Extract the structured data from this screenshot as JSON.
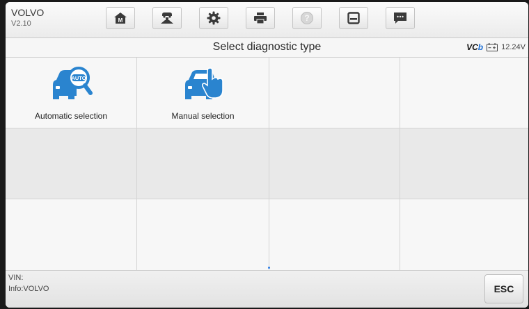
{
  "header": {
    "make": "VOLVO",
    "version": "V2.10",
    "toolbar": [
      {
        "icon": "home-m-icon"
      },
      {
        "icon": "vehicle-lift-icon"
      },
      {
        "icon": "gear-icon"
      },
      {
        "icon": "printer-icon"
      },
      {
        "icon": "help-icon",
        "disabled": true
      },
      {
        "icon": "save-icon"
      },
      {
        "icon": "message-icon"
      }
    ]
  },
  "titlebar": {
    "title": "Select diagnostic type",
    "vci_prefix": "VC",
    "vci_suffix": "b",
    "voltage": "12.24V"
  },
  "options": [
    {
      "label": "Automatic selection",
      "icon": "auto-car-magnifier-icon",
      "badge": "AUTO"
    },
    {
      "label": "Manual selection",
      "icon": "manual-car-hand-icon"
    }
  ],
  "footer": {
    "vin_label": "VIN:",
    "info_label": "Info:VOLVO",
    "esc_label": "ESC"
  },
  "colors": {
    "accent": "#1c6fd6",
    "icon_blue": "#2a84cf"
  }
}
